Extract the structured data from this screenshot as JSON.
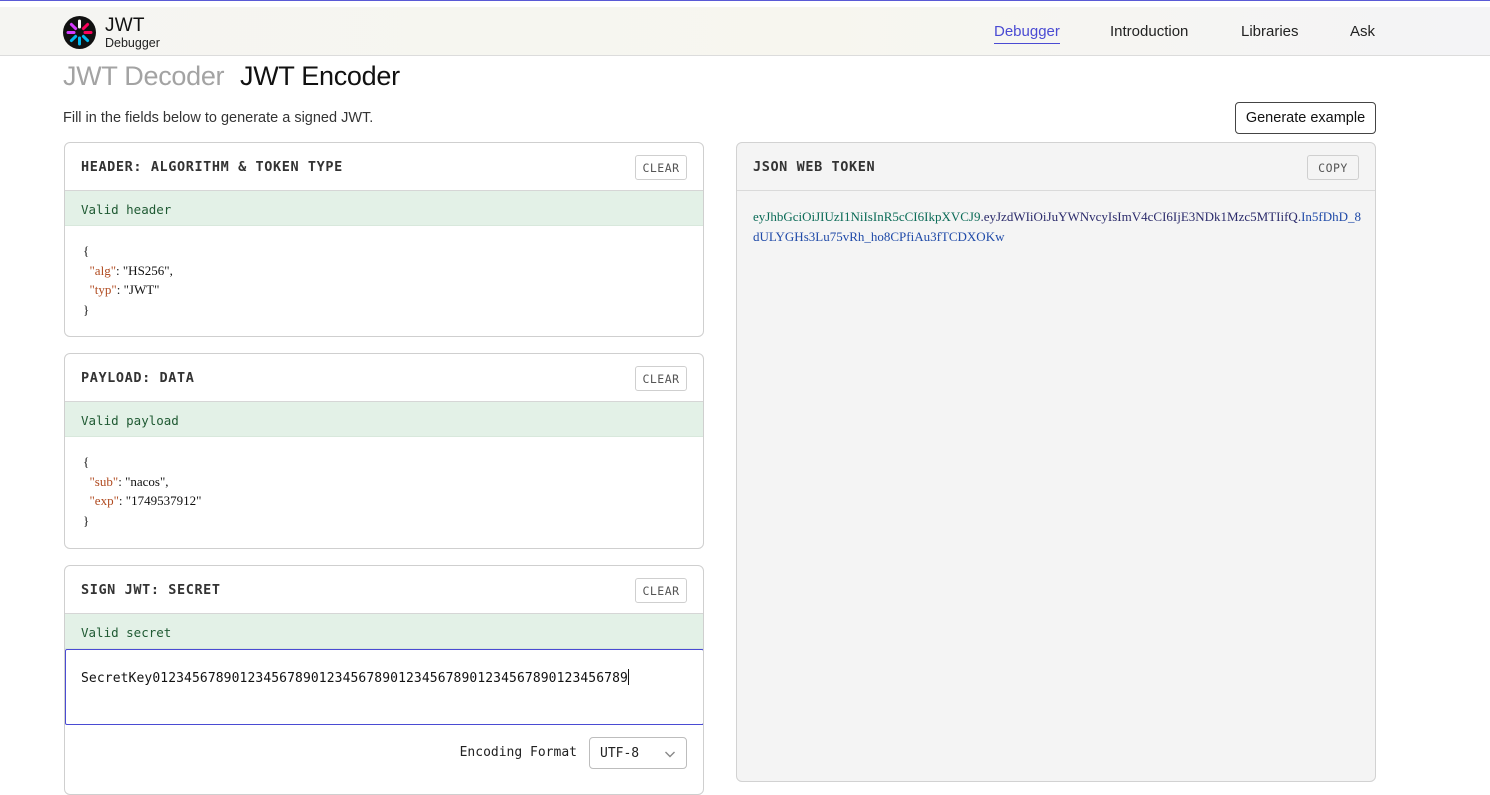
{
  "brand": {
    "title": "JWT",
    "subtitle": "Debugger"
  },
  "nav": {
    "debugger": "Debugger",
    "introduction": "Introduction",
    "libraries": "Libraries",
    "ask": "Ask"
  },
  "modes": {
    "decoder": "JWT Decoder",
    "encoder": "JWT Encoder"
  },
  "intro": "Fill in the fields below to generate a signed JWT.",
  "generate_button": "Generate example",
  "header_panel": {
    "title": "HEADER: ALGORITHM & TOKEN TYPE",
    "clear": "CLEAR",
    "status": "Valid header",
    "open_brace": "{",
    "close_brace": "}",
    "lines": [
      {
        "key": "\"alg\"",
        "value": "\"HS256\"",
        "sep": ": ",
        "end": ","
      },
      {
        "key": "\"typ\"",
        "value": "\"JWT\"",
        "sep": ": ",
        "end": ""
      }
    ]
  },
  "payload_panel": {
    "title": "PAYLOAD: DATA",
    "clear": "CLEAR",
    "status": "Valid payload",
    "open_brace": "{",
    "close_brace": "}",
    "lines": [
      {
        "key": "\"sub\"",
        "value": "\"nacos\"",
        "sep": ": ",
        "end": ","
      },
      {
        "key": "\"exp\"",
        "value": "\"1749537912\"",
        "sep": ": ",
        "end": ""
      }
    ]
  },
  "secret_panel": {
    "title": "SIGN JWT: SECRET",
    "clear": "CLEAR",
    "status": "Valid secret",
    "secret_value": "SecretKey012345678901234567890123456789012345678901234567890123456789",
    "encoding_label": "Encoding Format",
    "encoding_value": "UTF-8"
  },
  "token_panel": {
    "title": "JSON WEB TOKEN",
    "copy": "COPY",
    "header_part": "eyJhbGciOiJIUzI1NiIsInR5cCI6IkpXVCJ9",
    "dot1": ".",
    "payload_part": "eyJzdWIiOiJuYWNvcyIsImV4cCI6IjE3NDk1Mzc5MTIifQ",
    "dot2": ".",
    "signature_part": "In5fDhD_8dULYGHs3Lu75vRh_ho8CPfiAu3fTCDXOKw"
  },
  "colors": {
    "accent": "#4a4bd3",
    "valid_bg": "#e3f1e7",
    "token_header": "#0b6b57",
    "token_signature": "#1f4aa8"
  },
  "icons": {
    "logo": "jwt-logo",
    "select_chevron": "chevron-down-icon"
  }
}
